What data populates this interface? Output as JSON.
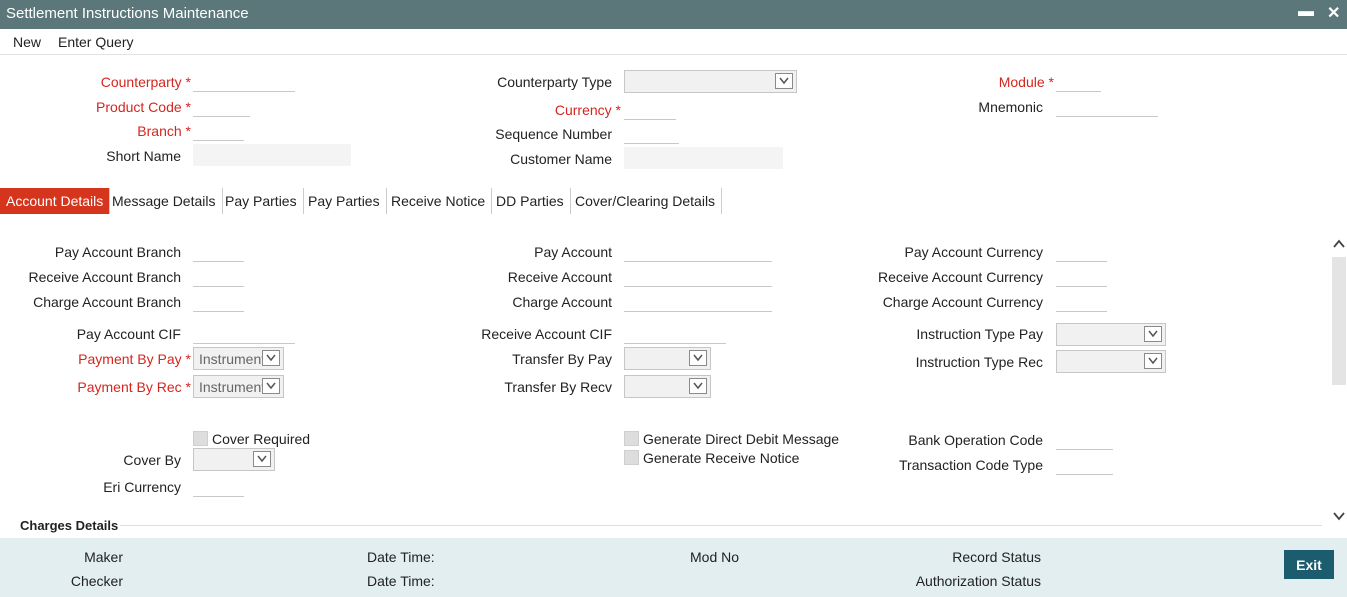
{
  "window": {
    "title": "Settlement Instructions Maintenance",
    "minimize": "▬",
    "close": "✕"
  },
  "menu": {
    "new": "New",
    "enter_query": "Enter Query"
  },
  "header": {
    "counterparty": "Counterparty",
    "product_code": "Product Code",
    "branch": "Branch",
    "short_name": "Short Name",
    "counterparty_type": "Counterparty Type",
    "currency": "Currency",
    "sequence_number": "Sequence Number",
    "customer_name": "Customer Name",
    "module": "Module",
    "mnemonic": "Mnemonic",
    "star": "*"
  },
  "tabs": [
    "Account Details",
    "Message Details",
    "Pay Parties",
    "Pay Parties",
    "Receive Notice",
    "DD Parties",
    "Cover/Clearing Details"
  ],
  "account": {
    "pay_account_branch": "Pay Account Branch",
    "receive_account_branch": "Receive Account Branch",
    "charge_account_branch": "Charge Account Branch",
    "pay_account_cif": "Pay Account CIF",
    "payment_by_pay": "Payment By Pay",
    "payment_by_rec": "Payment By Rec",
    "pay_account": "Pay Account",
    "receive_account": "Receive Account",
    "charge_account": "Charge Account",
    "receive_account_cif": "Receive Account CIF",
    "transfer_by_pay": "Transfer By Pay",
    "transfer_by_recv": "Transfer By Recv",
    "pay_account_currency": "Pay Account Currency",
    "receive_account_currency": "Receive Account Currency",
    "charge_account_currency": "Charge Account Currency",
    "instruction_type_pay": "Instruction Type Pay",
    "instruction_type_rec": "Instruction Type Rec",
    "instrument_value": "Instrument",
    "cover_required": "Cover Required",
    "cover_by": "Cover By",
    "eri_currency": "Eri Currency",
    "generate_dd_message": "Generate Direct Debit Message",
    "generate_receive_notice": "Generate Receive Notice",
    "bank_operation_code": "Bank Operation Code",
    "transaction_code_type": "Transaction Code Type",
    "charges_details": "Charges Details"
  },
  "footer": {
    "maker": "Maker",
    "checker": "Checker",
    "date_time": "Date Time:",
    "mod_no": "Mod No",
    "record_status": "Record Status",
    "authorization_status": "Authorization Status",
    "exit": "Exit"
  }
}
